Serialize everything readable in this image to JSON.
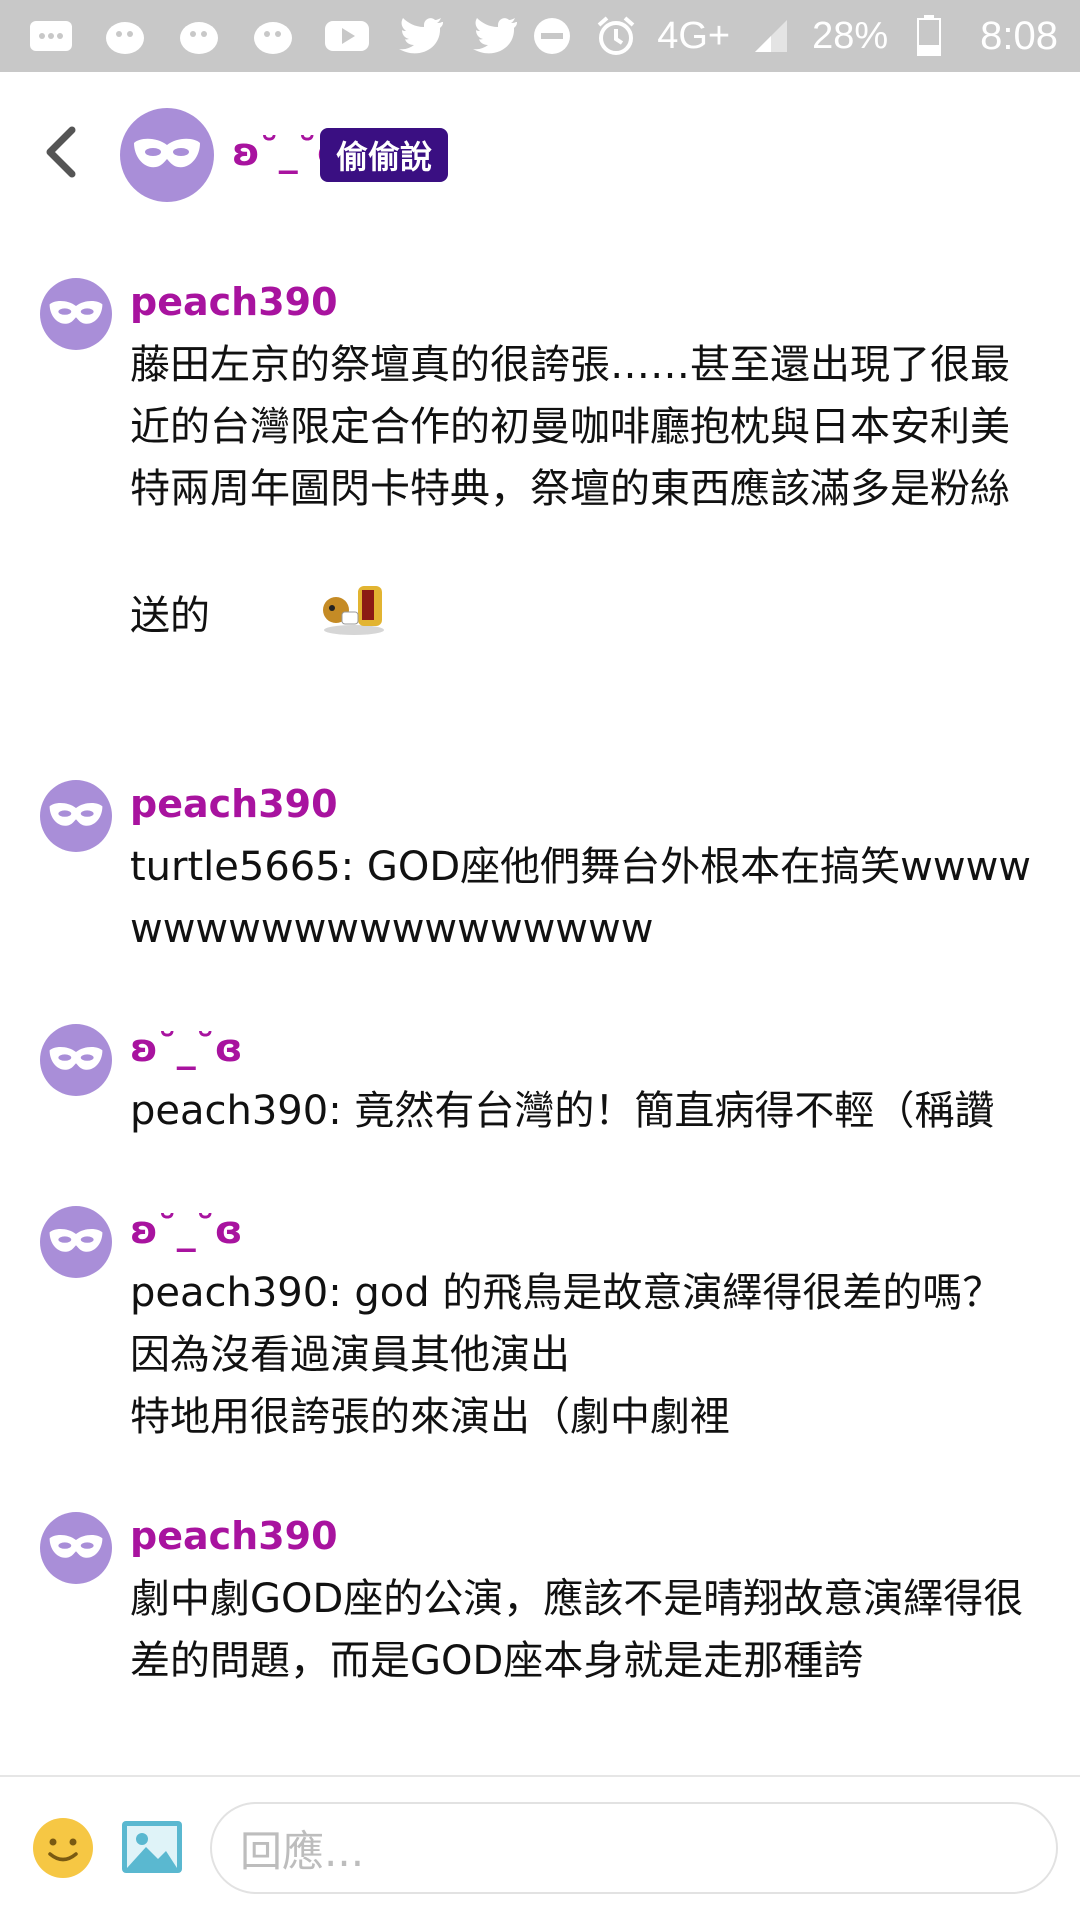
{
  "status_bar": {
    "left_icons": [
      "message-icon",
      "ghost-icon-1",
      "ghost-icon-2",
      "ghost-icon-3",
      "youtube-icon",
      "twitter-icon-1",
      "twitter-icon-2"
    ],
    "network": "4G+",
    "battery": "28%",
    "time": "8:08"
  },
  "header": {
    "title": "ʚ˘_˘ɞ",
    "badge": "偷偷說"
  },
  "messages": [
    {
      "author": "peach390",
      "text": "藤田左京的祭壇真的很誇張……甚至還出現了很最近的台灣限定合作的初曼咖啡廳抱枕與日本安利美特兩周年圖閃卡特典，祭壇的東西應該滿多是粉絲送的",
      "has_sticker": true
    },
    {
      "author": "peach390",
      "text": "turtle5665: GOD座他們舞台外根本在搞笑wwwwwwwwwwwwwwwwwwww",
      "has_sticker": false
    },
    {
      "author": "ʚ˘_˘ɞ",
      "text": "peach390: 竟然有台灣的！簡直病得不輕（稱讚",
      "has_sticker": false
    },
    {
      "author": "ʚ˘_˘ɞ",
      "text": "peach390: god 的飛鳥是故意演繹得很差的嗎？\n因為沒看過演員其他演出\n特地用很誇張的來演出（劇中劇裡",
      "has_sticker": false
    },
    {
      "author": "peach390",
      "text": "劇中劇GOD座的公演，應該不是晴翔故意演繹得很差的問題，而是GOD座本身就是走那種誇",
      "has_sticker": false
    }
  ],
  "composer": {
    "placeholder": "回應..."
  },
  "colors": {
    "accent_purple": "#a8139f",
    "avatar_bg": "#a98ed8",
    "badge_bg": "#3a0f82",
    "status_bar_bg": "#c8c8c8"
  }
}
